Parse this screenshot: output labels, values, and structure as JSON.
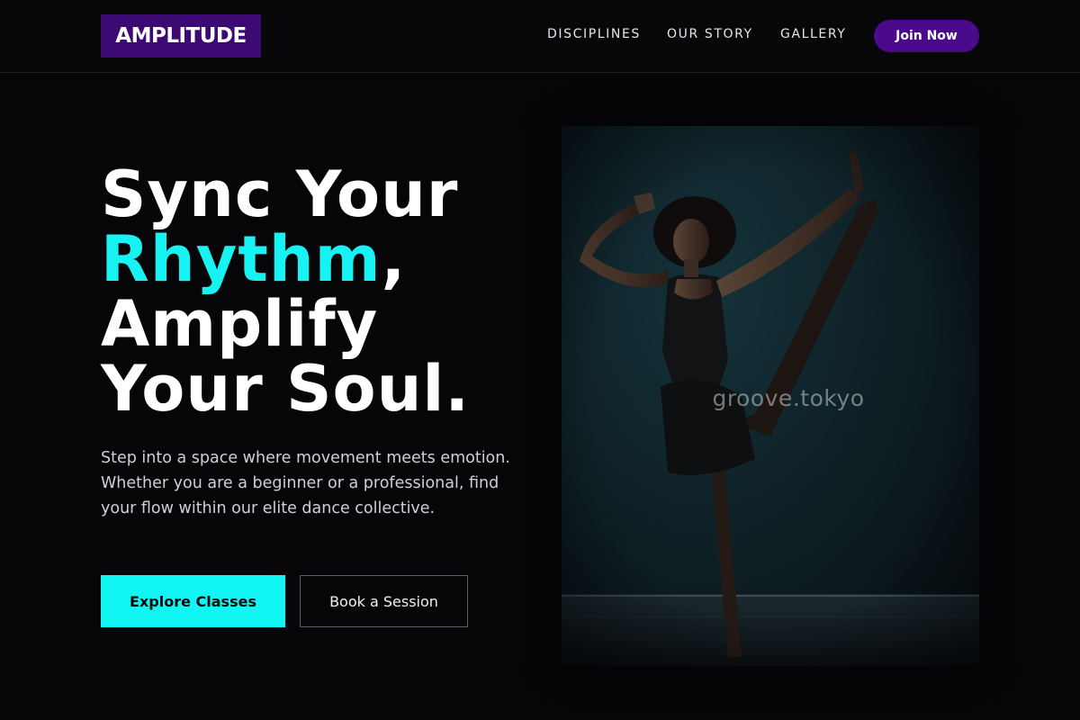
{
  "brand": {
    "logo_text": "AMPLITUDE",
    "accent_color": "#3d0a73"
  },
  "nav": {
    "items": [
      {
        "label": "DISCIPLINES"
      },
      {
        "label": "OUR STORY"
      },
      {
        "label": "GALLERY"
      }
    ],
    "cta_label": "Join Now",
    "cta_color": "#4b0a8c"
  },
  "hero": {
    "headline": {
      "line1": "Sync Your",
      "line2_accent": "Rhythm",
      "line2_rest": ",",
      "line3": "Amplify",
      "line4": "Your Soul."
    },
    "accent_color": "#17f3f3",
    "description": "Step into a space where movement meets emotion. Whether you are a beginner or a professional, find your flow within our elite dance collective.",
    "primary_button": "Explore Classes",
    "secondary_button": "Book a Session"
  },
  "image": {
    "subject": "dancer-photo",
    "watermark": "groove.tokyo"
  }
}
